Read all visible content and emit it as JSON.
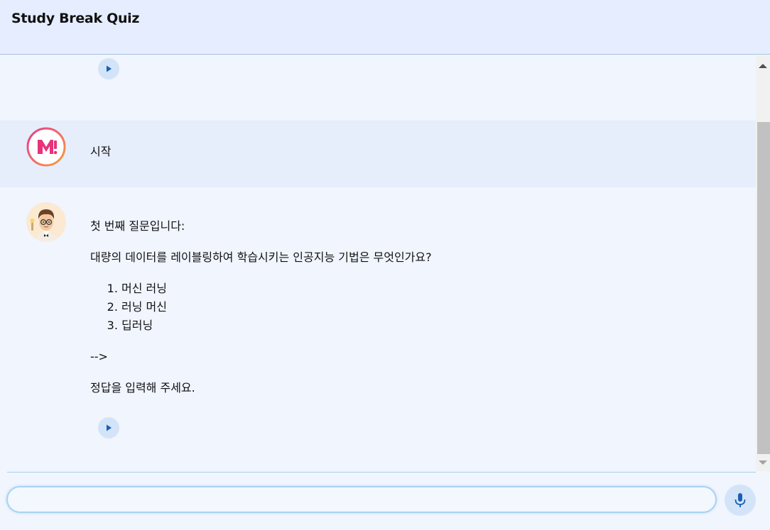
{
  "header": {
    "title": "Study Break Quiz"
  },
  "user_message": {
    "avatar_icon": "m-logo-icon",
    "text": "시작"
  },
  "bot_message": {
    "avatar_icon": "cartoon-teacher-avatar",
    "intro": "첫 번째 질문입니다:",
    "question": "대량의 데이터를 레이블링하여 학습시키는 인공지능 기법은 무엇인가요?",
    "options": [
      "머신 러닝",
      "러닝 머신",
      "딥러닝"
    ],
    "arrow_text": "-->",
    "prompt": "정답을 입력해 주세요."
  },
  "input": {
    "value": "",
    "placeholder": ""
  },
  "colors": {
    "header_bg": "#e6edfe",
    "page_bg": "#f0f5fe",
    "user_row_bg": "#e6eefc",
    "button_bg": "#d3e4f8",
    "icon_blue": "#1a5fb4",
    "logo_pink": "#e8337a"
  }
}
